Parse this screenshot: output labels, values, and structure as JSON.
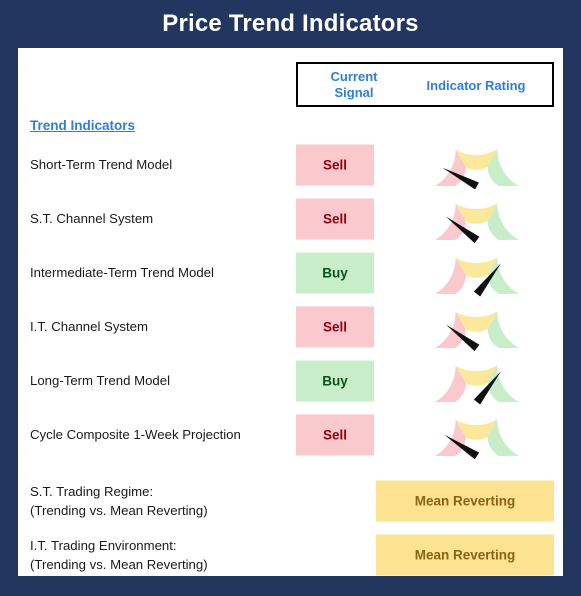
{
  "window": {
    "title": "Price Trend Indicators"
  },
  "colors": {
    "frame_navy": "#22365f",
    "panel_white": "#ffffff",
    "accent_blue": "#2f7ed8",
    "sell_bg": "#fac9cd",
    "sell_text": "#94000f",
    "buy_bg": "#c8edc9",
    "buy_text": "#0c5215",
    "regime_bg": "#fbe391",
    "regime_text": "#8a6410",
    "gauge_red": "#fac9cd",
    "gauge_yellow": "#fbe89a",
    "gauge_green": "#c8edc9",
    "needle": "#111111"
  },
  "table": {
    "header": {
      "current_signal": "Current\nSignal",
      "current_signal_line1": "Current",
      "current_signal_line2": "Signal",
      "indicator_rating": "Indicator Rating"
    },
    "section_heading": "Trend Indicators",
    "rows": [
      {
        "label": "Short-Term Trend Model",
        "signal": "Sell",
        "signal_type": "sell",
        "gauge_value": 18,
        "needle_angle_deg": 152
      },
      {
        "label": "S.T. Channel System",
        "signal": "Sell",
        "signal_type": "sell",
        "gauge_value": 21,
        "needle_angle_deg": 143
      },
      {
        "label": "Intermediate-Term Trend Model",
        "signal": "Buy",
        "signal_type": "buy",
        "gauge_value": 71,
        "needle_angle_deg": 52
      },
      {
        "label": "I.T. Channel System",
        "signal": "Sell",
        "signal_type": "sell",
        "gauge_value": 21,
        "needle_angle_deg": 143
      },
      {
        "label": "Long-Term Trend Model",
        "signal": "Buy",
        "signal_type": "buy",
        "gauge_value": 71,
        "needle_angle_deg": 52
      },
      {
        "label": "Cycle Composite 1-Week Projection",
        "signal": "Sell",
        "signal_type": "sell",
        "gauge_value": 19,
        "needle_angle_deg": 147
      }
    ],
    "regime_rows": [
      {
        "label": "S.T. Trading Regime:\n(Trending vs. Mean Reverting)",
        "value": "Mean Reverting"
      },
      {
        "label": "I.T. Trading Environment:\n(Trending vs. Mean Reverting)",
        "value": "Mean Reverting"
      }
    ]
  },
  "chart_data": {
    "type": "gauge-table",
    "title": "Price Trend Indicators",
    "gauge_zones": [
      {
        "name": "Bearish",
        "from": 0,
        "to": 33,
        "color": "#fac9cd"
      },
      {
        "name": "Neutral",
        "from": 33,
        "to": 66,
        "color": "#fbe89a"
      },
      {
        "name": "Bullish",
        "from": 66,
        "to": 100,
        "color": "#c8edc9"
      }
    ],
    "categories": [
      "Short-Term Trend Model",
      "S.T. Channel System",
      "Intermediate-Term Trend Model",
      "I.T. Channel System",
      "Long-Term Trend Model",
      "Cycle Composite 1-Week Projection"
    ],
    "series": [
      {
        "name": "Indicator Rating",
        "values": [
          18,
          21,
          71,
          21,
          71,
          19
        ]
      }
    ],
    "signals": [
      "Sell",
      "Sell",
      "Buy",
      "Sell",
      "Buy",
      "Sell"
    ],
    "regimes": [
      "Mean Reverting",
      "Mean Reverting"
    ],
    "ylim": [
      0,
      100
    ],
    "xlabel": "",
    "ylabel": "",
    "legend": [
      "Current Signal",
      "Indicator Rating"
    ]
  }
}
